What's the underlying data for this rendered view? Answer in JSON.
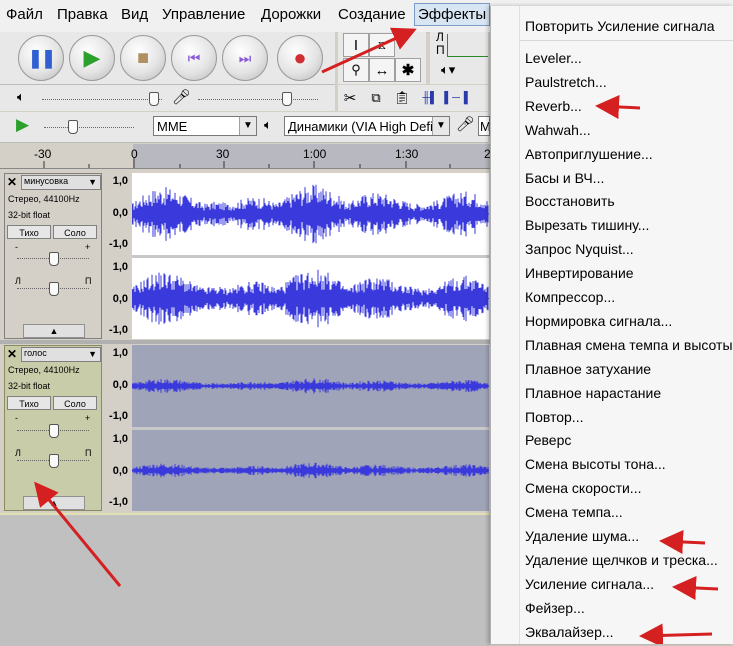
{
  "menubar": {
    "items": [
      "Файл",
      "Правка",
      "Вид",
      "Управление",
      "Дорожки",
      "Создание",
      "Эффекты"
    ]
  },
  "transport": {
    "buttons": [
      "pause",
      "play",
      "stop",
      "skip-to-start",
      "skip-to-end",
      "record"
    ]
  },
  "meter": {
    "left_label": "Л",
    "right_label": "П"
  },
  "device": {
    "host": "MME",
    "output": "Динамики (VIA High Defi",
    "input_partial": "M"
  },
  "ruler": {
    "labels": [
      "-30",
      "0",
      "30",
      "1:00",
      "1:30",
      "2"
    ]
  },
  "tracks": [
    {
      "name": "минусовка",
      "format": "Стерео, 44100Hz",
      "bits": "32-bit float",
      "mute": "Тихо",
      "solo": "Соло",
      "gain_minus": "-",
      "gain_plus": "+",
      "pan_left": "Л",
      "pan_right": "П",
      "scale": [
        "1,0",
        "0,0",
        "-1,0",
        "1,0",
        "0,0",
        "-1,0"
      ]
    },
    {
      "name": "голос",
      "format": "Стерео, 44100Hz",
      "bits": "32-bit float",
      "mute": "Тихо",
      "solo": "Соло",
      "gain_minus": "-",
      "gain_plus": "+",
      "pan_left": "Л",
      "pan_right": "П",
      "scale": [
        "1,0",
        "0,0",
        "-1,0",
        "1,0",
        "0,0",
        "-1,0"
      ]
    }
  ],
  "effects_menu": {
    "items": [
      "Повторить Усиление сигнала",
      "Leveler...",
      "Paulstretch...",
      "Reverb...",
      "Wahwah...",
      "Автоприглушение...",
      "Басы и ВЧ...",
      "Восстановить",
      "Вырезать тишину...",
      "Запрос Nyquist...",
      "Инвертирование",
      "Компрессор...",
      "Нормировка сигнала...",
      "Плавная смена темпа и высоты",
      "Плавное затухание",
      "Плавное нарастание",
      "Повтор...",
      "Реверс",
      "Смена высоты тона...",
      "Смена скорости...",
      "Смена темпа...",
      "Удаление шума...",
      "Удаление щелчков и треска...",
      "Усиление сигнала...",
      "Фейзер...",
      "Эквалайзер..."
    ]
  },
  "colors": {
    "waveform": "#3a3adc",
    "annotation_arrow": "#d42020",
    "track_selected_bg": "#a0a4b8"
  }
}
